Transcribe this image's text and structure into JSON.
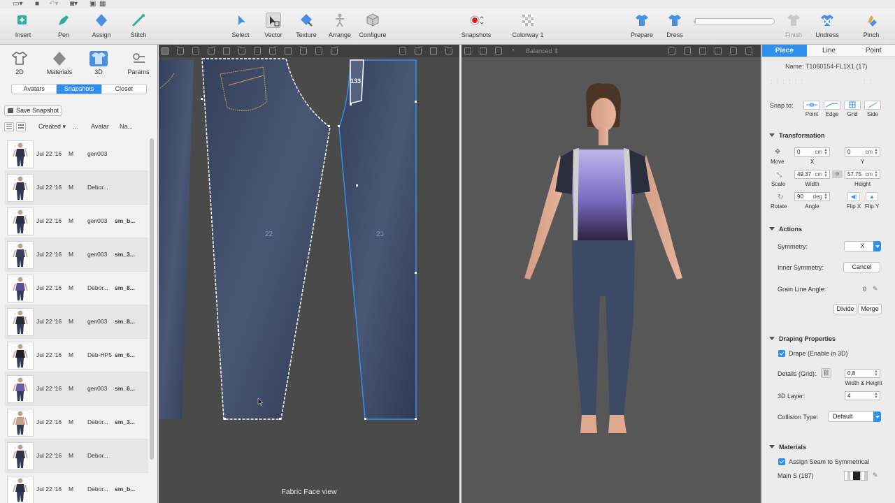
{
  "toolbar": {
    "tools": [
      {
        "id": "insert",
        "label": "Insert",
        "icon": "insert-icon"
      },
      {
        "id": "pen",
        "label": "Pen",
        "icon": "pen-icon"
      },
      {
        "id": "assign",
        "label": "Assign",
        "icon": "assign-icon"
      },
      {
        "id": "stitch",
        "label": "Stitch",
        "icon": "stitch-icon"
      },
      {
        "id": "select",
        "label": "Select",
        "icon": "select-arrow-icon"
      },
      {
        "id": "vector",
        "label": "Vector",
        "icon": "vector-icon"
      },
      {
        "id": "texture",
        "label": "Texture",
        "icon": "texture-icon"
      },
      {
        "id": "arrange",
        "label": "Arrange",
        "icon": "arrange-icon"
      },
      {
        "id": "configure",
        "label": "Configure",
        "icon": "configure-cube-icon"
      },
      {
        "id": "snapshots",
        "label": "Snapshots",
        "icon": "record-icon"
      },
      {
        "id": "colorway",
        "label": "Colorway 1",
        "icon": "colorway-icon"
      },
      {
        "id": "prepare",
        "label": "Prepare",
        "icon": "shirt-prepare-icon"
      },
      {
        "id": "dress",
        "label": "Dress",
        "icon": "shirt-dress-icon"
      },
      {
        "id": "finish",
        "label": "Finish",
        "icon": "shirt-finish-icon"
      },
      {
        "id": "undress",
        "label": "Undress",
        "icon": "shirt-undress-icon"
      },
      {
        "id": "pinch",
        "label": "Pinch",
        "icon": "pinch-icon"
      }
    ],
    "progress": 0.02
  },
  "left": {
    "top_tabs": [
      {
        "label": "2D",
        "icon": "shirt-2d-icon"
      },
      {
        "label": "Materials",
        "icon": "materials-diamond-icon"
      },
      {
        "label": "3D",
        "icon": "shirt-3d-icon"
      },
      {
        "label": "Params",
        "icon": "params-icon"
      }
    ],
    "subtabs": [
      "Avatars",
      "Snapshots",
      "Closet"
    ],
    "active_subtab": "Snapshots",
    "save_snapshot": "Save Snapshot",
    "columns": {
      "created": "Created",
      "dots": "...",
      "avatar": "Avatar",
      "name": "Na..."
    },
    "snapshots": [
      {
        "date": "Jul 22 '16",
        "g": "M",
        "avatar": "gen003",
        "name": ""
      },
      {
        "date": "Jul 22 '16",
        "g": "M",
        "avatar": "Debor...",
        "name": ""
      },
      {
        "date": "Jul 22 '16",
        "g": "M",
        "avatar": "gen003",
        "name": "sm_b..."
      },
      {
        "date": "Jul 22 '16",
        "g": "M",
        "avatar": "gen003",
        "name": "sm_3..."
      },
      {
        "date": "Jul 22 '16",
        "g": "M",
        "avatar": "Debor...",
        "name": "sm_8..."
      },
      {
        "date": "Jul 22 '16",
        "g": "M",
        "avatar": "gen003",
        "name": "sm_8..."
      },
      {
        "date": "Jul 22 '16",
        "g": "M",
        "avatar": "Deb-HP5",
        "name": "sm_6..."
      },
      {
        "date": "Jul 22 '16",
        "g": "M",
        "avatar": "gen003",
        "name": "sm_6..."
      },
      {
        "date": "Jul 22 '16",
        "g": "M",
        "avatar": "Debor...",
        "name": "sm_3..."
      },
      {
        "date": "Jul 22 '16",
        "g": "M",
        "avatar": "Debor...",
        "name": ""
      },
      {
        "date": "Jul 22 '16",
        "g": "M",
        "avatar": "Debor...",
        "name": "sm_b..."
      }
    ]
  },
  "view2d": {
    "label": "Fabric Face view",
    "piece_left_number": "22",
    "piece_right_number": "21",
    "pocket_number": "133"
  },
  "view3d": {
    "quality": "Balanced"
  },
  "right": {
    "tabs": [
      "Piece",
      "Line",
      "Point"
    ],
    "active_tab": "Piece",
    "name_label": "Name: T1060154-FL1X1 (17)",
    "snap_to": "Snap to:",
    "snap_options": [
      "Point",
      "Edge",
      "Grid",
      "Side"
    ],
    "transformation": {
      "title": "Transformation",
      "move": "Move",
      "x_value": "0",
      "y_value": "0",
      "unit_cm": "cm",
      "x_label": "X",
      "y_label": "Y",
      "scale": "Scale",
      "width_value": "49.37",
      "height_value": "57.75",
      "width_label": "Width",
      "height_label": "Height",
      "rotate": "Rotate",
      "angle_value": "90",
      "unit_deg": "deg",
      "angle_label": "Angle",
      "flip_x": "Flip X",
      "flip_y": "Flip Y"
    },
    "actions": {
      "title": "Actions",
      "symmetry_label": "Symmetry:",
      "symmetry_value": "X",
      "inner_symmetry_label": "Inner Symmetry:",
      "cancel": "Cancel",
      "grain_label": "Grain Line Angle:",
      "grain_value": "0",
      "divide": "Divide",
      "merge": "Merge"
    },
    "draping": {
      "title": "Draping Properties",
      "drape_label": "Drape (Enable in 3D)",
      "details_label": "Details (Grid):",
      "details_value": "0.8",
      "wh_label": "Width & Height",
      "layer_label": "3D Layer:",
      "layer_value": "4",
      "collision_label": "Collision Type:",
      "collision_value": "Default"
    },
    "materials": {
      "title": "Materials",
      "assign_seam": "Assign Seam to Symmetrical",
      "main_label": "Main S (187)"
    }
  },
  "colors": {
    "accent": "#2f8fee",
    "denim": "#3c4a66",
    "stitch": "#c9a24a",
    "top_purple": "#7b6fbf"
  }
}
